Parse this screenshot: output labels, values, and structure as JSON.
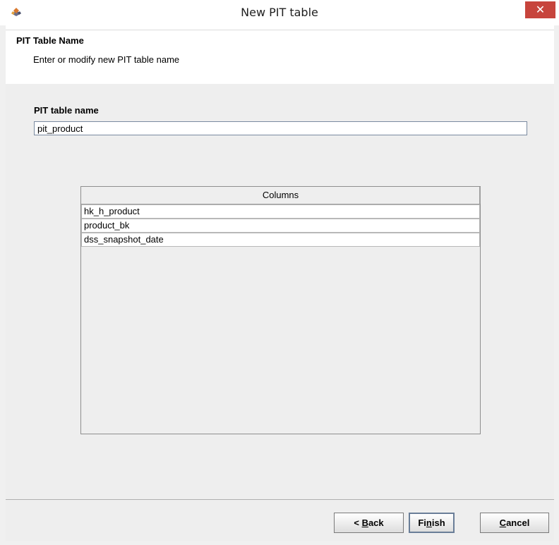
{
  "window": {
    "title": "New PIT table",
    "close_symbol": "✕",
    "app_icon": "app-logo-icon"
  },
  "header": {
    "title": "PIT Table Name",
    "description": "Enter or modify new PIT table name"
  },
  "form": {
    "name_label": "PIT table name",
    "name_value": "pit_product"
  },
  "columns_table": {
    "header": "Columns",
    "rows": [
      "hk_h_product",
      "product_bk",
      "dss_snapshot_date"
    ]
  },
  "buttons": {
    "back": {
      "prefix": "< ",
      "mnemonic": "B",
      "rest": "ack"
    },
    "finish": {
      "prefix": "Fi",
      "mnemonic": "n",
      "rest": "ish"
    },
    "cancel": {
      "prefix": "",
      "mnemonic": "C",
      "rest": "ancel"
    }
  },
  "colors": {
    "close_button": "#c7443c",
    "content_bg": "#eeeeee"
  }
}
